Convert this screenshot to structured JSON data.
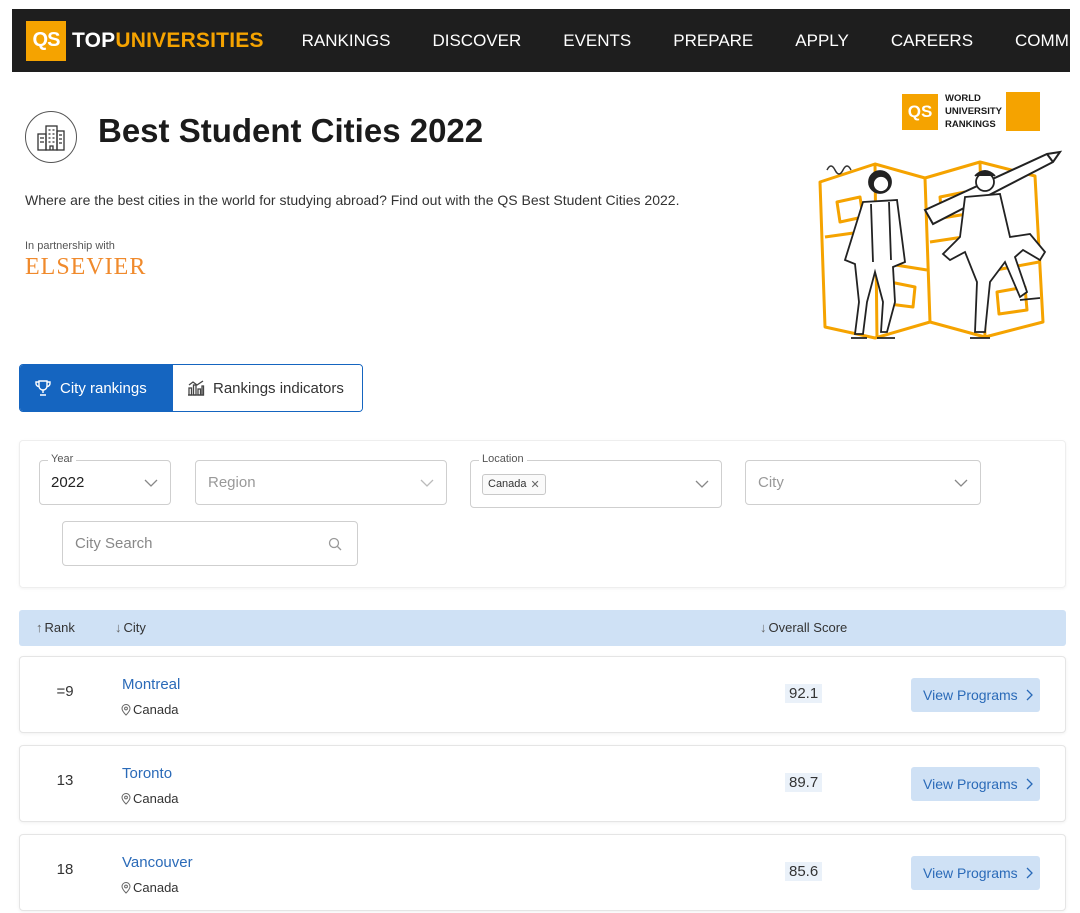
{
  "nav": {
    "logo_badge": "QS",
    "logo_top": "TOP",
    "logo_universities": "UNIVERSITIES",
    "items": [
      "RANKINGS",
      "DISCOVER",
      "EVENTS",
      "PREPARE",
      "APPLY",
      "CAREERS",
      "COMMUNITY"
    ]
  },
  "header": {
    "title": "Best Student Cities 2022",
    "subtitle": "Where are the best cities in the world for studying abroad? Find out with the QS Best Student Cities 2022.",
    "partner_label": "In partnership with",
    "partner_name": "ELSEVIER"
  },
  "wur_badge": {
    "badge": "QS",
    "lines": [
      "WORLD",
      "UNIVERSITY",
      "RANKINGS"
    ]
  },
  "tabs": [
    {
      "label": "City rankings",
      "icon": "trophy-icon",
      "active": true
    },
    {
      "label": "Rankings indicators",
      "icon": "bar-chart-icon",
      "active": false
    }
  ],
  "filters": {
    "year": {
      "legend": "Year",
      "value": "2022"
    },
    "region": {
      "placeholder": "Region"
    },
    "location": {
      "legend": "Location",
      "chip": "Canada"
    },
    "city": {
      "placeholder": "City"
    },
    "search": {
      "placeholder": "City Search"
    }
  },
  "table": {
    "columns": {
      "rank": "Rank",
      "city": "City",
      "score": "Overall Score"
    },
    "rows": [
      {
        "rank": "=9",
        "city": "Montreal",
        "country": "Canada",
        "score": "92.1",
        "action": "View Programs"
      },
      {
        "rank": "13",
        "city": "Toronto",
        "country": "Canada",
        "score": "89.7",
        "action": "View Programs"
      },
      {
        "rank": "18",
        "city": "Vancouver",
        "country": "Canada",
        "score": "85.6",
        "action": "View Programs"
      }
    ]
  },
  "colors": {
    "brand_orange": "#f5a300",
    "primary_blue": "#1565c0",
    "link_blue": "#2a6ab8",
    "header_bg": "#1e1e1e",
    "table_header_bg": "#cfe1f5",
    "elsevier_orange": "#f08a2c"
  }
}
